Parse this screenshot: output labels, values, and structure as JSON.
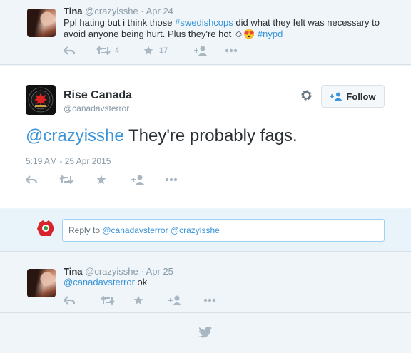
{
  "top_tweet": {
    "name": "Tina",
    "handle": "@crazyisshe",
    "dot": "·",
    "date": "Apr 24",
    "text_1": "Ppl hating but i think those ",
    "hashtag_1": "#swedishcops",
    "text_2": " did what they felt was necessary to",
    "text_3": "avoid anyone being hurt. Plus they're hot ",
    "emoji": "☺😍",
    "hashtag_2": " #nypd",
    "retweet_count": "4",
    "favorite_count": "17"
  },
  "main_tweet": {
    "name": "Rise Canada",
    "handle": "@canadavsterror",
    "follow_label": "Follow",
    "mention": "@crazyisshe",
    "text": " They're probably fags.",
    "timestamp": "5:19 AM - 25 Apr 2015"
  },
  "reply_box": {
    "prefix": "Reply to ",
    "mention_1": "@canadavsterror",
    "mention_2": " @crazyisshe"
  },
  "bottom_tweet": {
    "name": "Tina",
    "handle": "@crazyisshe",
    "dot": "·",
    "date": "Apr 25",
    "mention": "@canadavsterror",
    "text": " ok"
  },
  "colors": {
    "link": "#3b94d9",
    "action_icon": "#a9b7c2",
    "page_bg": "#eff5f9",
    "reply_bg": "#e8f3fa"
  },
  "icons": [
    "reply-icon",
    "retweet-icon",
    "favorite-icon",
    "follow-icon",
    "more-icon",
    "gear-icon",
    "twitter-bird-icon"
  ]
}
